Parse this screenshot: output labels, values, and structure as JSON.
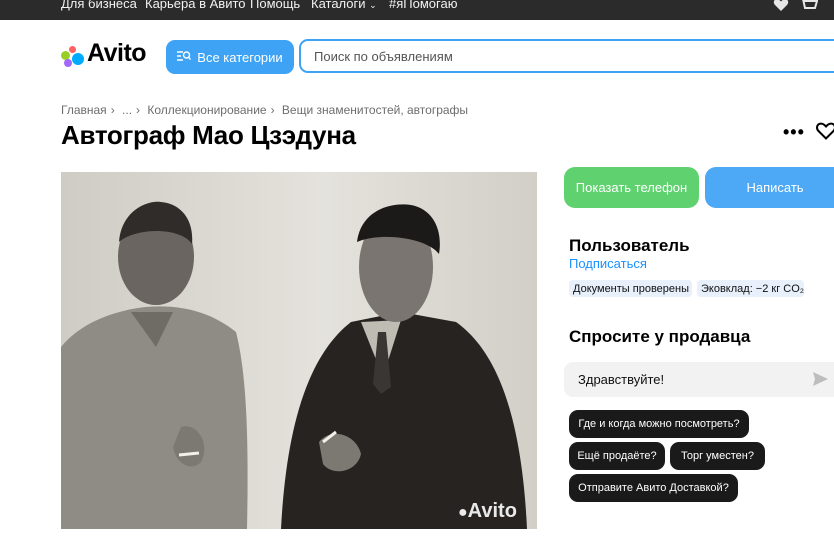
{
  "topbar": {
    "links": [
      "Для бизнеса",
      "Карьера в Авито",
      "Помощь",
      "Каталоги",
      "#яПомогаю"
    ]
  },
  "header": {
    "logo_text": "Avito",
    "categories_label": "Все категории",
    "search_placeholder": "Поиск по объявлениям"
  },
  "breadcrumbs": [
    "Главная",
    "...",
    "Коллекционирование",
    "Вещи знаменитостей, автографы"
  ],
  "listing": {
    "title": "Автограф Мао Цзэдуна",
    "watermark": "Avito"
  },
  "actions": {
    "show_phone": "Показать телефон",
    "write": "Написать"
  },
  "seller": {
    "name": "Пользователь",
    "subscribe": "Подписаться",
    "badges": [
      "Документы проверены",
      "Эковклад: −2 кг CO₂"
    ]
  },
  "ask": {
    "heading": "Спросите у продавца",
    "input_value": "Здравствуйте!",
    "chips": [
      "Где и когда можно посмотреть?",
      "Ещё продаёте?",
      "Торг уместен?",
      "Отправите Авито Доставкой?"
    ]
  },
  "colors": {
    "accent_blue": "#3ea3f5",
    "green": "#5fd26f",
    "link": "#1a90ff",
    "logo_dots": [
      "#97cf26",
      "#a169f7",
      "#ff6163",
      "#00aaff"
    ]
  }
}
